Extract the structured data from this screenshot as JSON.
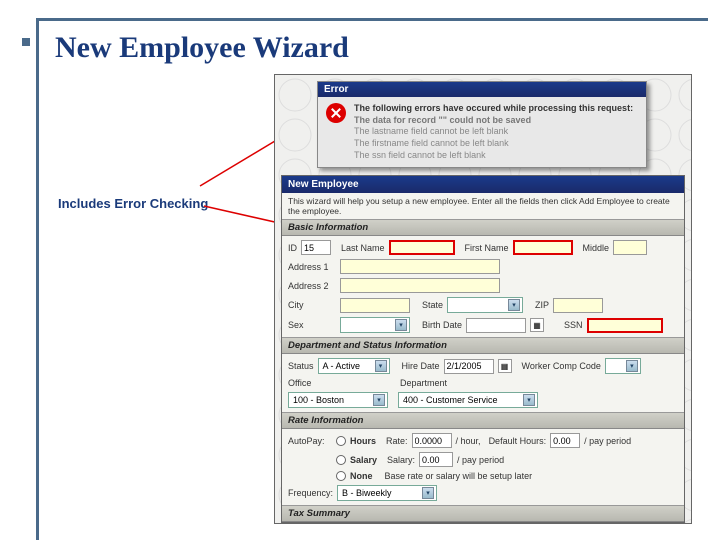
{
  "slide": {
    "title": "New Employee Wizard",
    "callout": "Includes Error Checking"
  },
  "error": {
    "title": "Error",
    "lead": "The following errors have occured while processing this request:",
    "sub": "The data for record \"\" could not be saved",
    "lines": [
      "The lastname field cannot be left blank",
      "The firstname field cannot be left blank",
      "The ssn field cannot be left blank"
    ]
  },
  "wizard": {
    "title": "New Employee",
    "desc": "This wizard will help you setup a new employee. Enter all the fields then click Add Employee to create the employee.",
    "sections": {
      "basic": "Basic Information",
      "dept": "Department and Status Information",
      "rate": "Rate Information",
      "tax": "Tax Summary"
    },
    "basic": {
      "id_lbl": "ID",
      "id_val": "15",
      "lastname_lbl": "Last Name",
      "lastname_val": "",
      "firstname_lbl": "First Name",
      "firstname_val": "",
      "middle_lbl": "Middle",
      "middle_val": "",
      "addr1_lbl": "Address 1",
      "addr1_val": "",
      "addr2_lbl": "Address 2",
      "addr2_val": "",
      "city_lbl": "City",
      "city_val": "",
      "state_lbl": "State",
      "state_val": "",
      "zip_lbl": "ZIP",
      "zip_val": "",
      "sex_lbl": "Sex",
      "sex_val": "",
      "birth_lbl": "Birth Date",
      "birth_val": "",
      "ssn_lbl": "SSN",
      "ssn_val": ""
    },
    "dept": {
      "status_lbl": "Status",
      "status_val": "A - Active",
      "hire_lbl": "Hire Date",
      "hire_val": "2/1/2005",
      "wcc_lbl": "Worker Comp Code",
      "wcc_val": "",
      "office_lbl": "Office",
      "office_val": "100 - Boston",
      "department_lbl": "Department",
      "department_val": "400 - Customer Service"
    },
    "rate": {
      "autopay_lbl": "AutoPay:",
      "hours_lbl": "Hours",
      "rate_lbl": "Rate:",
      "rate_val": "0.0000",
      "rate_unit": "/ hour,",
      "defhrs_lbl": "Default Hours:",
      "defhrs_val": "0.00",
      "defhrs_unit": "/ pay period",
      "salary_lbl": "Salary",
      "salary_field_lbl": "Salary:",
      "salary_val": "0.00",
      "salary_unit": "/ pay period",
      "none_lbl": "None",
      "none_desc": "Base rate or salary will be setup later",
      "freq_lbl": "Frequency:",
      "freq_val": "B - Biweekly"
    }
  }
}
